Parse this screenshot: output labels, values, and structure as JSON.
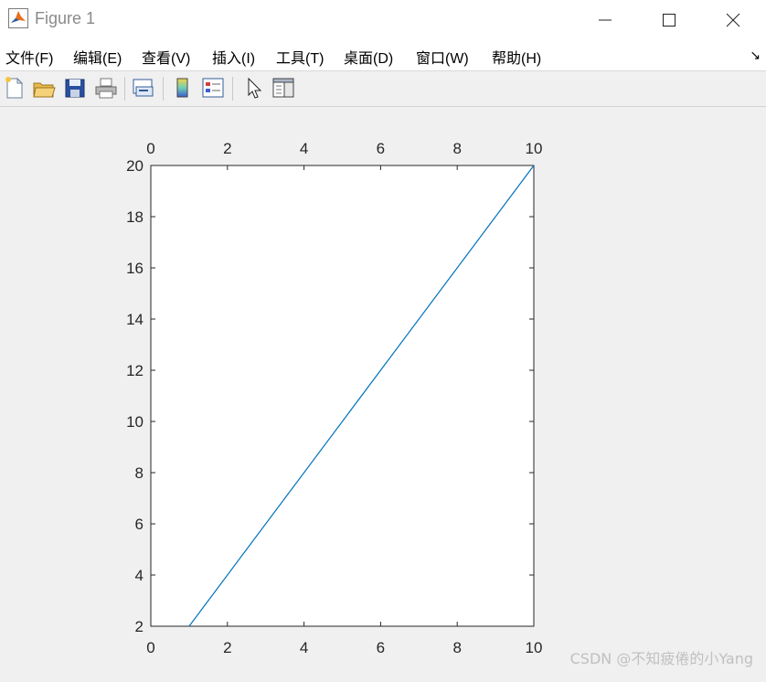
{
  "window": {
    "title": "Figure 1"
  },
  "menu": {
    "items": [
      {
        "label": "文件(F)"
      },
      {
        "label": "编辑(E)"
      },
      {
        "label": "查看(V)"
      },
      {
        "label": "插入(I)"
      },
      {
        "label": "工具(T)"
      },
      {
        "label": "桌面(D)"
      },
      {
        "label": "窗口(W)"
      },
      {
        "label": "帮助(H)"
      }
    ]
  },
  "toolbar": {
    "icons": [
      "new-figure-icon",
      "open-file-icon",
      "save-icon",
      "print-icon",
      "link-plot-icon",
      "colorbar-icon",
      "legend-icon",
      "pointer-icon",
      "property-inspector-icon"
    ]
  },
  "chart_data": {
    "type": "line",
    "x": [
      1,
      10
    ],
    "y": [
      2,
      20
    ],
    "xlim": [
      0,
      10
    ],
    "ylim": [
      2,
      20
    ],
    "xticks": [
      0,
      2,
      4,
      6,
      8,
      10
    ],
    "yticks": [
      2,
      4,
      6,
      8,
      10,
      12,
      14,
      16,
      18,
      20
    ],
    "x_tick_labels": [
      "0",
      "2",
      "4",
      "6",
      "8",
      "10"
    ],
    "y_tick_labels": [
      "2",
      "4",
      "6",
      "8",
      "10",
      "12",
      "14",
      "16",
      "18",
      "20"
    ],
    "top_tick_labels": [
      "0",
      "2",
      "4",
      "6",
      "8",
      "10"
    ],
    "line_color": "#0072bd",
    "grid": false,
    "box": true
  },
  "watermark": {
    "text": "CSDN @不知疲倦的小Yang"
  }
}
